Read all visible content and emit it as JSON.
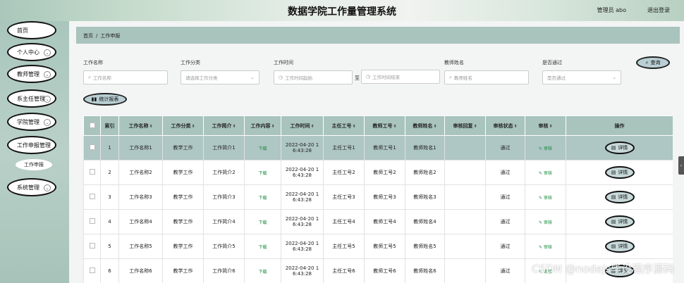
{
  "header": {
    "title": "数据学院工作量管理系统",
    "user": "管理员 abo",
    "logout": "退出登录"
  },
  "sidebar": {
    "items": [
      {
        "label": "首页"
      },
      {
        "label": "个人中心"
      },
      {
        "label": "教师管理"
      },
      {
        "label": "系主任管理"
      },
      {
        "label": "学院管理"
      },
      {
        "label": "工作申报管理"
      },
      {
        "label": "系统管理"
      }
    ],
    "sub_item": "工作申报"
  },
  "breadcrumb": {
    "home": "首页",
    "separator": "/",
    "current": "工作申报"
  },
  "filters": {
    "name": {
      "label": "工作名称",
      "placeholder": "工作名称"
    },
    "category": {
      "label": "工作分类",
      "placeholder": "请选择工作分类"
    },
    "time": {
      "label": "工作时间",
      "start_placeholder": "工作时间起始",
      "end_placeholder": "工作时间结束",
      "to": "至"
    },
    "teacher": {
      "label": "教师姓名",
      "placeholder": "教师姓名"
    },
    "passed": {
      "label": "是否通过",
      "placeholder": "是否通过"
    },
    "search_button": "查询",
    "stats_button": "统计报表"
  },
  "table": {
    "columns": [
      "索引",
      "工作名称",
      "工作分类",
      "工作简介",
      "工作内容",
      "工作时间",
      "主任工号",
      "教师工号",
      "教师姓名",
      "审核回复",
      "审核状态",
      "审核",
      "操作"
    ],
    "rows": [
      {
        "index": "1",
        "name": "工作名称1",
        "category": "教学工作",
        "intro": "工作简介1",
        "content": "下载",
        "time1": "2022-04-20 1",
        "time2": "6:43:28",
        "director": "主任工号1",
        "teacher_no": "教师工号1",
        "teacher_name": "教师姓名1",
        "reply": "",
        "status": "通过",
        "audit": "审核",
        "action": "详情"
      },
      {
        "index": "2",
        "name": "工作名称2",
        "category": "教学工作",
        "intro": "工作简介2",
        "content": "下载",
        "time1": "2022-04-20 1",
        "time2": "6:43:28",
        "director": "主任工号2",
        "teacher_no": "教师工号2",
        "teacher_name": "教师姓名2",
        "reply": "",
        "status": "通过",
        "audit": "审核",
        "action": "详情"
      },
      {
        "index": "3",
        "name": "工作名称3",
        "category": "教学工作",
        "intro": "工作简介3",
        "content": "下载",
        "time1": "2022-04-20 1",
        "time2": "6:43:28",
        "director": "主任工号3",
        "teacher_no": "教师工号3",
        "teacher_name": "教师姓名3",
        "reply": "",
        "status": "通过",
        "audit": "审核",
        "action": "详情"
      },
      {
        "index": "4",
        "name": "工作名称4",
        "category": "教学工作",
        "intro": "工作简介4",
        "content": "下载",
        "time1": "2022-04-20 1",
        "time2": "6:43:28",
        "director": "主任工号4",
        "teacher_no": "教师工号4",
        "teacher_name": "教师姓名4",
        "reply": "",
        "status": "通过",
        "audit": "审核",
        "action": "详情"
      },
      {
        "index": "5",
        "name": "工作名称5",
        "category": "教学工作",
        "intro": "工作简介5",
        "content": "下载",
        "time1": "2022-04-20 1",
        "time2": "6:43:28",
        "director": "主任工号5",
        "teacher_no": "教师工号5",
        "teacher_name": "教师姓名5",
        "reply": "",
        "status": "通过",
        "audit": "审核",
        "action": "详情"
      },
      {
        "index": "6",
        "name": "工作名称6",
        "category": "教学工作",
        "intro": "工作简介6",
        "content": "下载",
        "time1": "2022-04-20 1",
        "time2": "6:43:28",
        "director": "主任工号6",
        "teacher_no": "教师工号6",
        "teacher_name": "教师姓名6",
        "reply": "",
        "status": "通过",
        "audit": "审核",
        "action": "详情"
      }
    ]
  },
  "watermark": "CSDN @nodejs毕设程序源码",
  "colors": {
    "accent": "#a9c4bd",
    "download": "#178a3b"
  }
}
